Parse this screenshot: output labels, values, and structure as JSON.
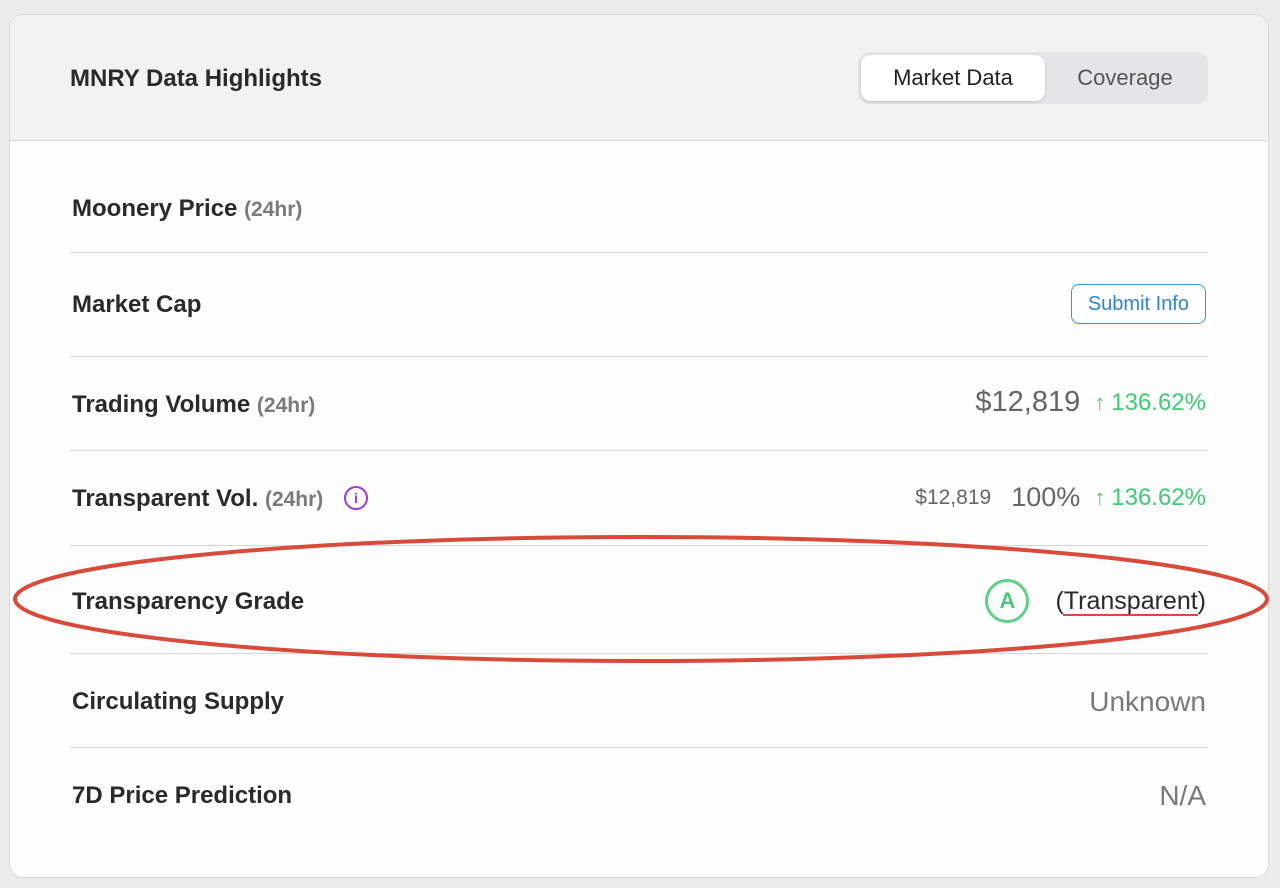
{
  "header": {
    "title": "MNRY Data Highlights",
    "tabs": [
      {
        "label": "Market Data",
        "active": true
      },
      {
        "label": "Coverage",
        "active": false
      }
    ]
  },
  "rows": {
    "price": {
      "label": "Moonery Price",
      "suffix": "(24hr)"
    },
    "market_cap": {
      "label": "Market Cap",
      "button": "Submit Info"
    },
    "trading_volume": {
      "label": "Trading Volume",
      "suffix": "(24hr)",
      "value": "$12,819",
      "change": "136.62%"
    },
    "transparent_vol": {
      "label": "Transparent Vol.",
      "suffix": "(24hr)",
      "value": "$12,819",
      "percent": "100%",
      "change": "136.62%"
    },
    "transparency_grade": {
      "label": "Transparency Grade",
      "grade": "A",
      "grade_text": "(Transparent)"
    },
    "circulating_supply": {
      "label": "Circulating Supply",
      "value": "Unknown"
    },
    "price_prediction": {
      "label": "7D Price Prediction",
      "value": "N/A"
    }
  },
  "colors": {
    "accent_blue": "#2f84d4",
    "positive_green": "#3ecb73",
    "info_purple": "#9b3ad6",
    "annotation_red": "#d94a3a"
  },
  "icons": {
    "up": "arrow-up-icon",
    "info": "info-icon"
  }
}
